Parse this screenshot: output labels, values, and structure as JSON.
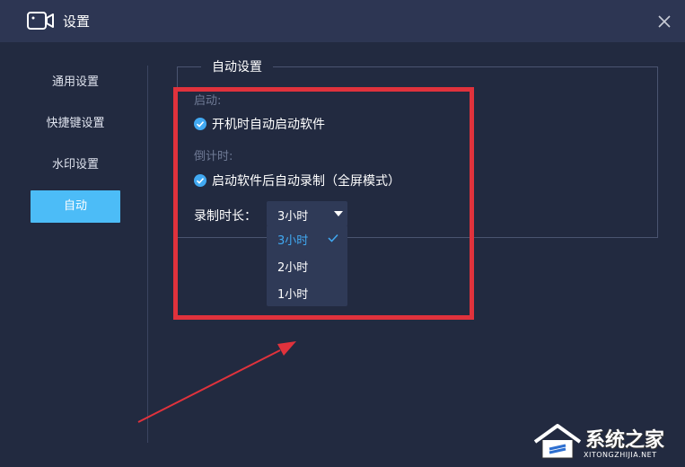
{
  "window": {
    "title": "设置",
    "close_icon": "close-icon",
    "app_icon": "camera-icon"
  },
  "sidebar": {
    "items": [
      {
        "label": "通用设置"
      },
      {
        "label": "快捷键设置"
      },
      {
        "label": "水印设置"
      },
      {
        "label": "自动",
        "active": true
      }
    ]
  },
  "auto_settings": {
    "legend": "自动设置",
    "startup_label": "启动:",
    "startup_option": {
      "label": "开机时自动启动软件",
      "checked": true
    },
    "countdown_label": "倒计时:",
    "countdown_option": {
      "label": "启动软件后自动录制（全屏模式）",
      "checked": true
    },
    "duration_label": "录制时长：",
    "duration_value": "3小时",
    "duration_options": [
      {
        "label": "3小时",
        "selected": true
      },
      {
        "label": "2小时",
        "selected": false
      },
      {
        "label": "1小时",
        "selected": false
      }
    ]
  },
  "watermark": {
    "name": "系统之家",
    "url": "XITONGZHIJIA.NET"
  },
  "colors": {
    "background": "#222a40",
    "titlebar": "#2d3653",
    "accent": "#4cbcf7",
    "checkbox": "#41a9f2",
    "annotation": "#e0323c"
  }
}
